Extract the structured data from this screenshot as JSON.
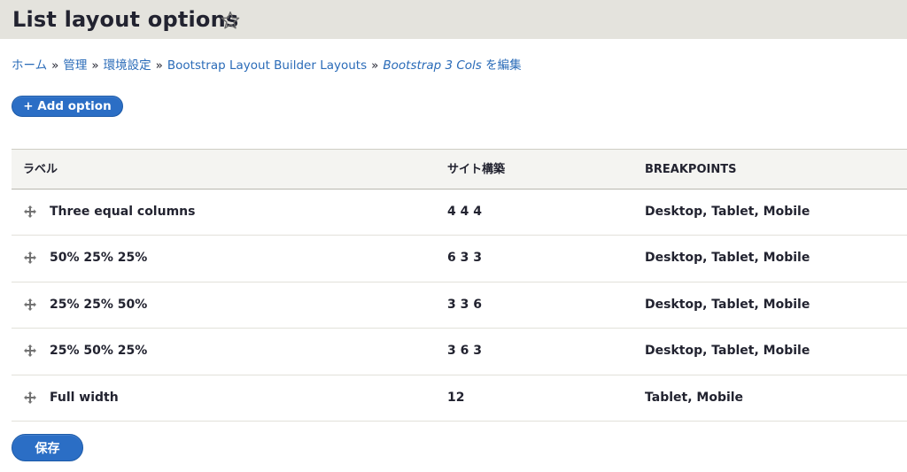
{
  "header": {
    "title": "List layout options",
    "shortcut_icon": "star-outline-icon"
  },
  "breadcrumb": {
    "items": [
      "ホーム",
      "管理",
      "環境設定",
      "Bootstrap Layout Builder Layouts"
    ],
    "current_italic": "Bootstrap 3 Cols",
    "current_suffix": " を編集",
    "separator": "»"
  },
  "actions": {
    "add_option": "+ Add option"
  },
  "table": {
    "columns": [
      "ラベル",
      "サイト構築",
      "BREAKPOINTS"
    ],
    "rows": [
      {
        "label": "Three equal columns",
        "structure": "4 4 4",
        "breakpoints": "Desktop, Tablet, Mobile"
      },
      {
        "label": "50% 25% 25%",
        "structure": "6 3 3",
        "breakpoints": "Desktop, Tablet, Mobile"
      },
      {
        "label": "25% 25% 50%",
        "structure": "3 3 6",
        "breakpoints": "Desktop, Tablet, Mobile"
      },
      {
        "label": "25% 50% 25%",
        "structure": "3 6 3",
        "breakpoints": "Desktop, Tablet, Mobile"
      },
      {
        "label": "Full width",
        "structure": "12",
        "breakpoints": "Tablet, Mobile"
      }
    ]
  },
  "form": {
    "save_label": "保存"
  },
  "colors": {
    "primary_button": "#2b6ec5",
    "link": "#2a6bb8",
    "header_bg": "#e4e3dd"
  }
}
